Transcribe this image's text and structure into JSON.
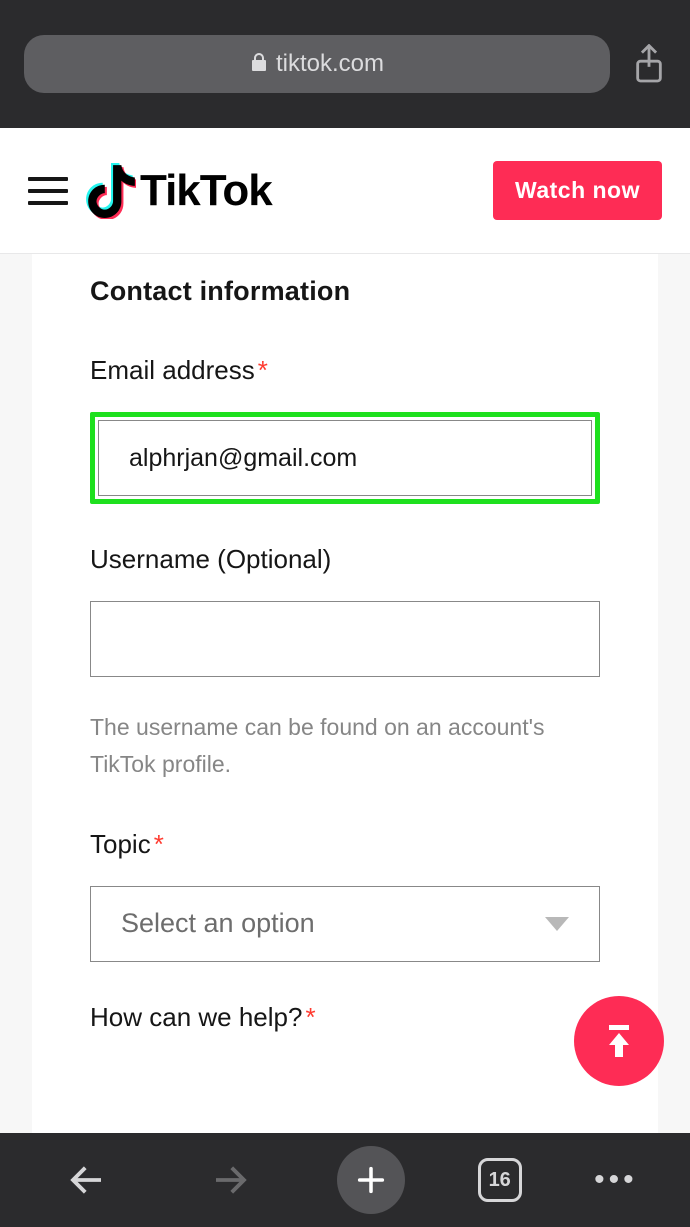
{
  "browser": {
    "url_host": "tiktok.com",
    "tab_count": "16"
  },
  "header": {
    "brand": "TikTok",
    "watch_now": "Watch now"
  },
  "form": {
    "section_title": "Contact information",
    "email_label": "Email address",
    "email_value": "alphrjan@gmail.com",
    "username_label": "Username (Optional)",
    "username_value": "",
    "username_hint": "The username can be found on an account's TikTok profile.",
    "topic_label": "Topic",
    "topic_placeholder": "Select an option",
    "help_label": "How can we help?"
  },
  "colors": {
    "accent": "#fe2c55",
    "highlight": "#1ee01e"
  }
}
